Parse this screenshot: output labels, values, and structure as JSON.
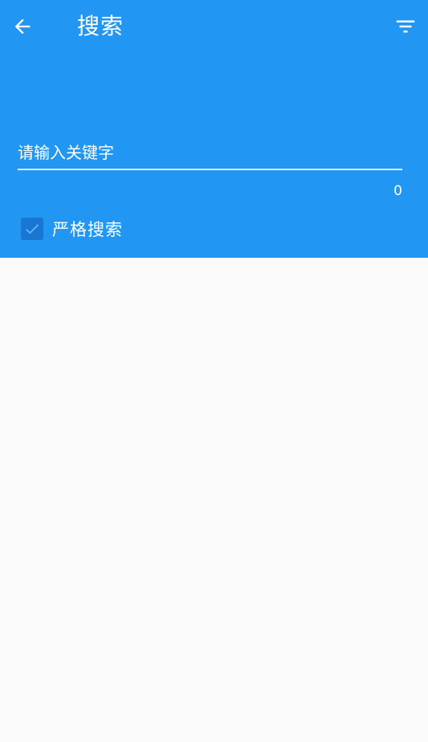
{
  "header": {
    "title": "搜索",
    "back_icon": "arrow-back-icon",
    "filter_icon": "filter-list-icon",
    "background_color": "#2196f3"
  },
  "search": {
    "placeholder": "请输入关键字",
    "value": "",
    "char_count": "0"
  },
  "strict_search": {
    "label": "严格搜索",
    "checked": true,
    "checkbox_color": "#1976d2"
  },
  "results": []
}
